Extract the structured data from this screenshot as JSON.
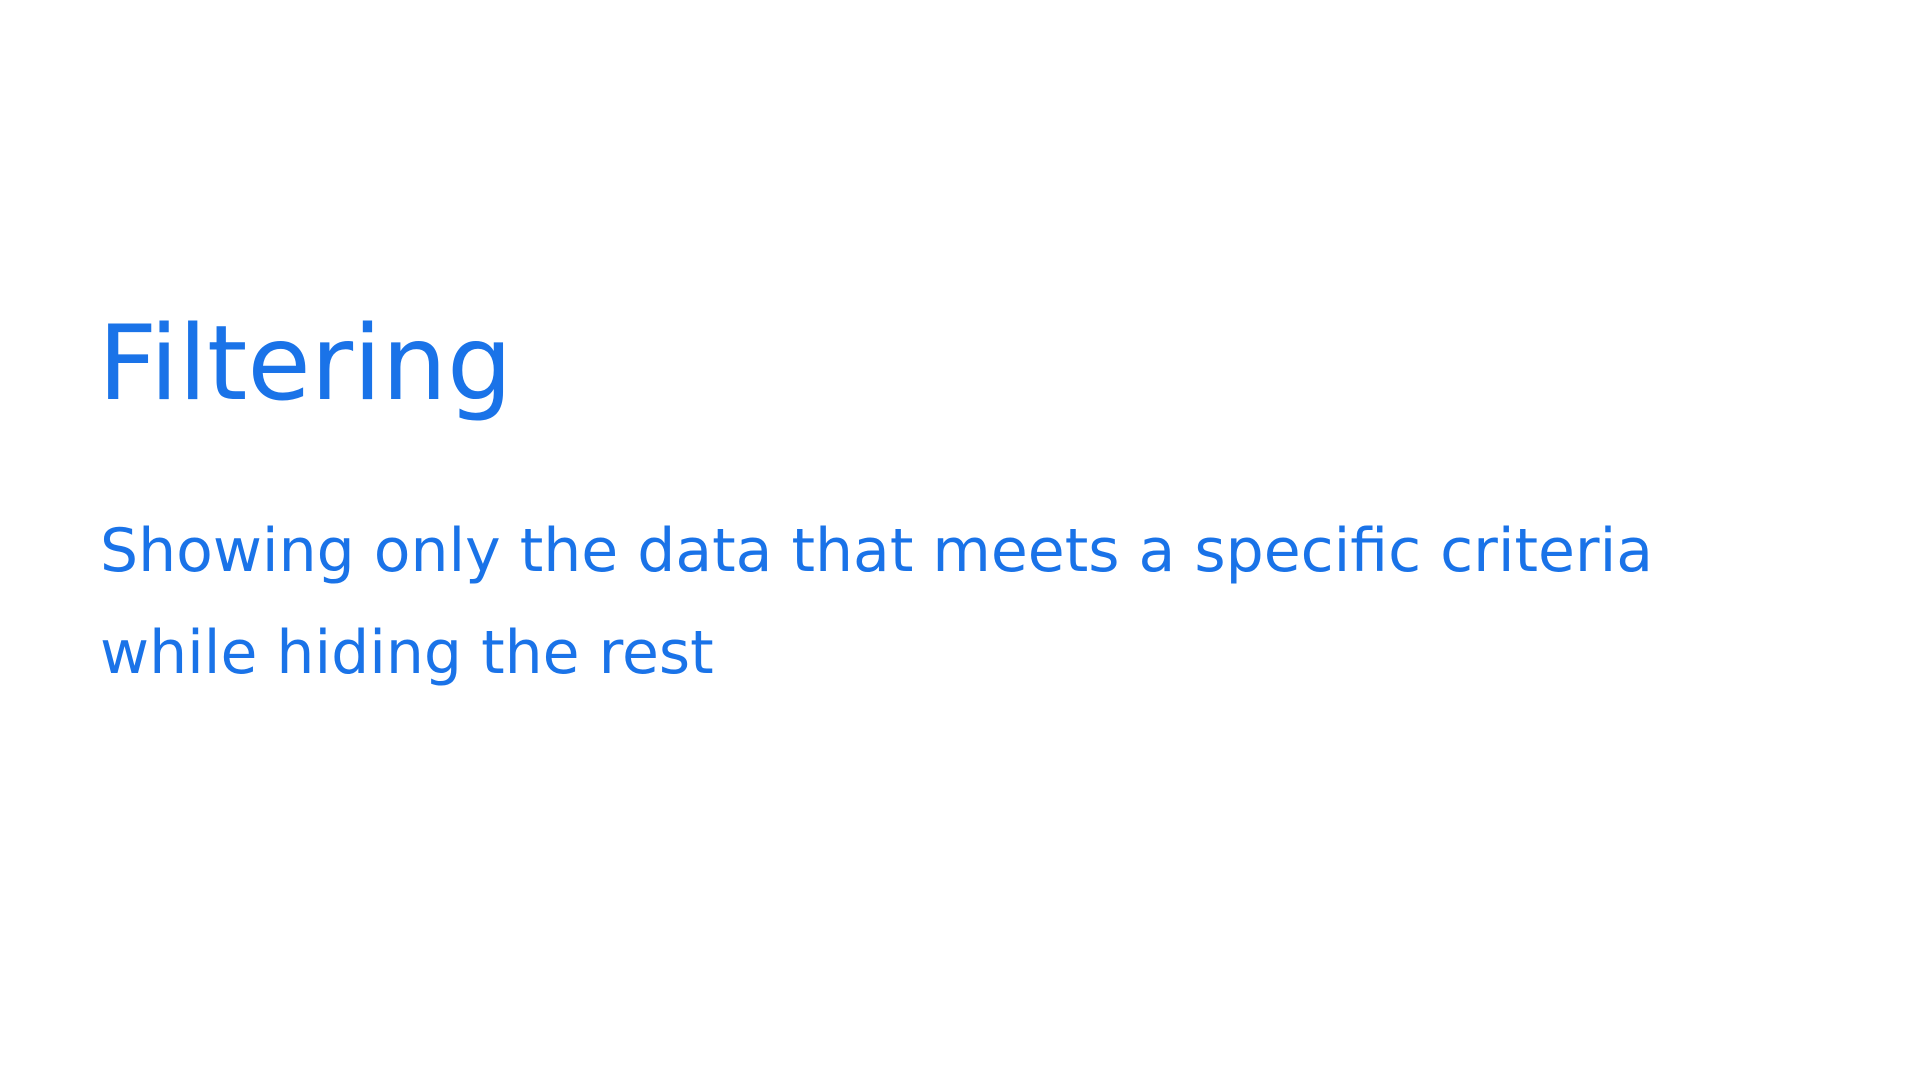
{
  "slide": {
    "title": "Filtering",
    "body_lines": [
      "Showing only the data that meets a specific criteria",
      "while hiding the rest"
    ],
    "colors": {
      "background": "#ffffff",
      "text": "#1a73e8"
    }
  }
}
